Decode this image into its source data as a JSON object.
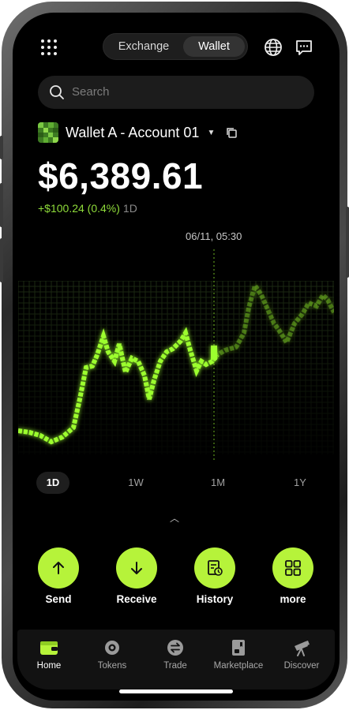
{
  "header": {
    "tabs": [
      {
        "label": "Exchange",
        "active": false
      },
      {
        "label": "Wallet",
        "active": true
      }
    ],
    "icons": [
      "grid-icon",
      "globe-icon",
      "message-icon"
    ]
  },
  "search": {
    "placeholder": "Search"
  },
  "account": {
    "name": "Wallet A - Account 01"
  },
  "balance": {
    "amount": "$6,389.61",
    "change": "+$100.24 (0.4%)",
    "period": "1D"
  },
  "chart": {
    "cursor_label": "06/11, 05:30",
    "accent_color": "#9cff2e",
    "ranges": [
      {
        "label": "1D",
        "active": true
      },
      {
        "label": "1W",
        "active": false
      },
      {
        "label": "1M",
        "active": false
      },
      {
        "label": "1Y",
        "active": false
      }
    ]
  },
  "actions": [
    {
      "label": "Send",
      "icon": "arrow-up-icon"
    },
    {
      "label": "Receive",
      "icon": "arrow-down-icon"
    },
    {
      "label": "History",
      "icon": "history-icon"
    },
    {
      "label": "more",
      "icon": "apps-grid-icon"
    }
  ],
  "nav": [
    {
      "label": "Home",
      "icon": "wallet-icon",
      "active": true
    },
    {
      "label": "Tokens",
      "icon": "token-icon",
      "active": false
    },
    {
      "label": "Trade",
      "icon": "swap-icon",
      "active": false
    },
    {
      "label": "Marketplace",
      "icon": "marketplace-icon",
      "active": false
    },
    {
      "label": "Discover",
      "icon": "telescope-icon",
      "active": false
    }
  ],
  "colors": {
    "accent": "#b6f33a",
    "positive": "#8fdc3a",
    "background": "#000000"
  }
}
